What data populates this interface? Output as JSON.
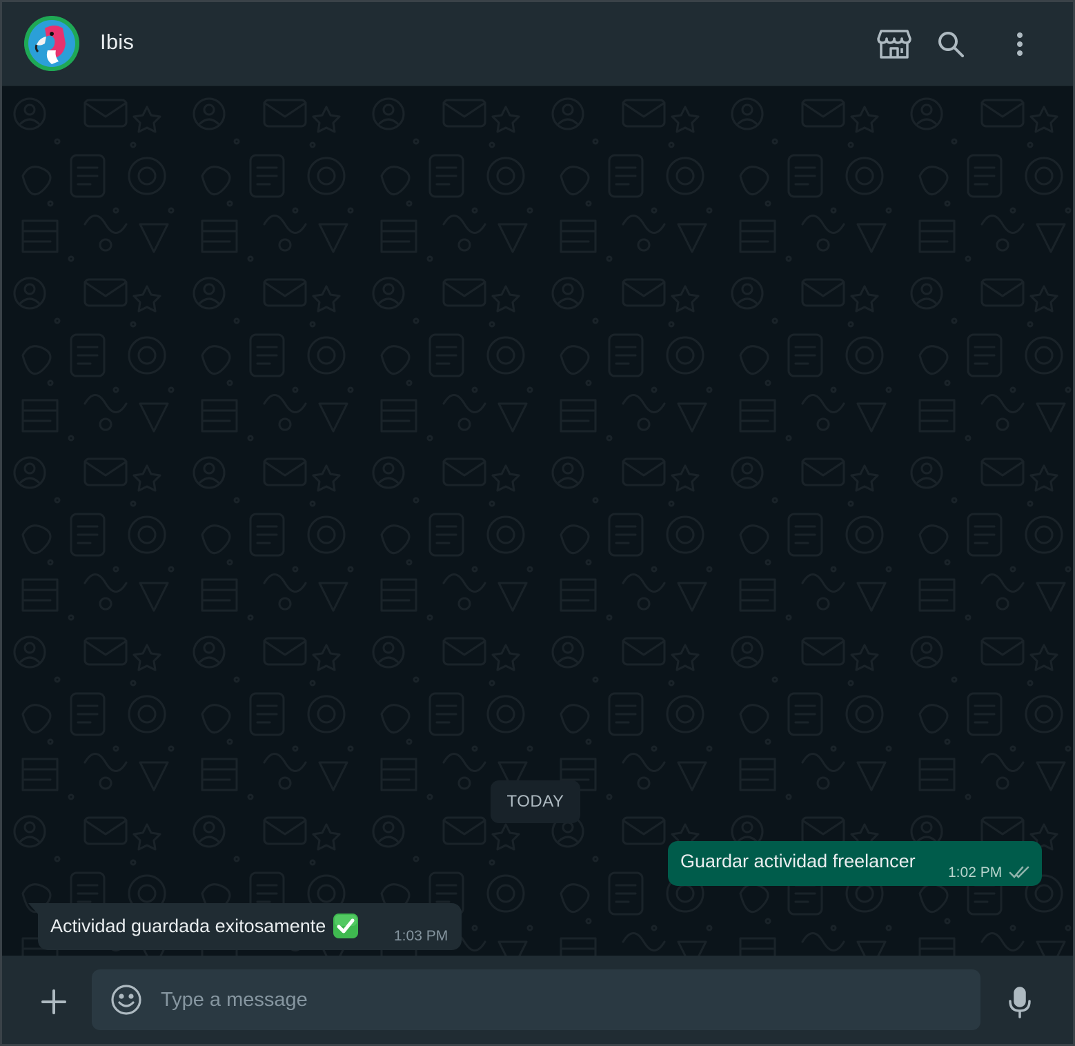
{
  "header": {
    "contact_name": "Ibis",
    "icons": [
      "catalog-store-icon",
      "search-icon",
      "menu-dots-icon"
    ]
  },
  "chat": {
    "date_divider": "TODAY",
    "messages": [
      {
        "direction": "outgoing",
        "text": "Guardar actividad freelancer",
        "time": "1:02 PM",
        "status": "read-double-tick"
      },
      {
        "direction": "incoming",
        "text": "Actividad guardada exitosamente",
        "time": "1:03 PM",
        "emoji": "check-mark-button"
      }
    ]
  },
  "composer": {
    "placeholder": "Type a message",
    "value": ""
  },
  "colors": {
    "header_bg": "#202c33",
    "chat_bg": "#0b141a",
    "outgoing_bubble": "#005c4b",
    "incoming_bubble": "#202c33",
    "input_bg": "#2a3942",
    "icon": "#aebac1"
  }
}
